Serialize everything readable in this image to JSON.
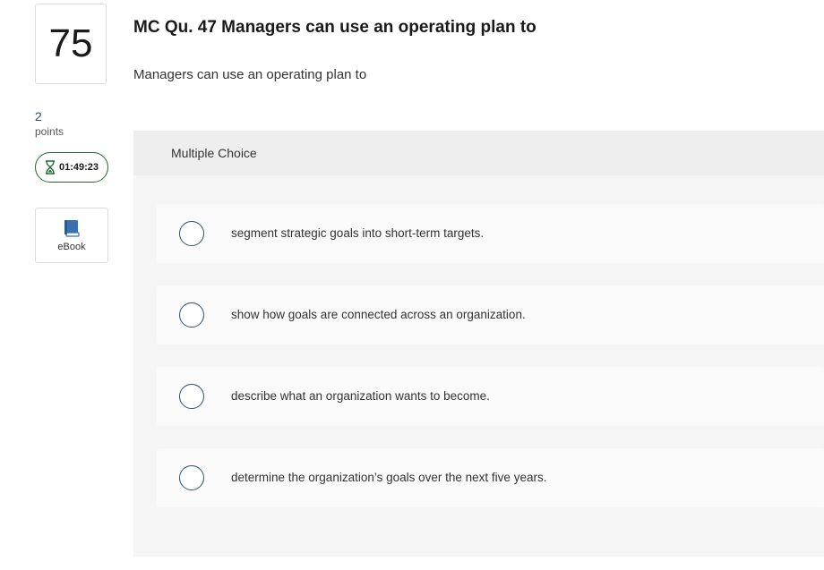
{
  "question": {
    "number": "75",
    "points_value": "2",
    "points_label": "points",
    "timer": "01:49:23",
    "ebook_label": "eBook",
    "title": "MC Qu. 47 Managers can use an operating plan to",
    "prompt": "Managers can use an operating plan to"
  },
  "multiple_choice": {
    "header": "Multiple Choice",
    "options": [
      {
        "label": "segment strategic goals into short-term targets."
      },
      {
        "label": "show how goals are connected across an organization."
      },
      {
        "label": "describe what an organization wants to become."
      },
      {
        "label": "determine the organization’s goals over the next five years."
      }
    ]
  },
  "colors": {
    "accent": "#2b4f78",
    "timer_border": "#1e6a2e",
    "panel_bg": "#f5f5f5",
    "ebook_icon": "#3a6fb0"
  },
  "icons": {
    "timer": "hourglass-icon",
    "ebook": "book-icon"
  }
}
